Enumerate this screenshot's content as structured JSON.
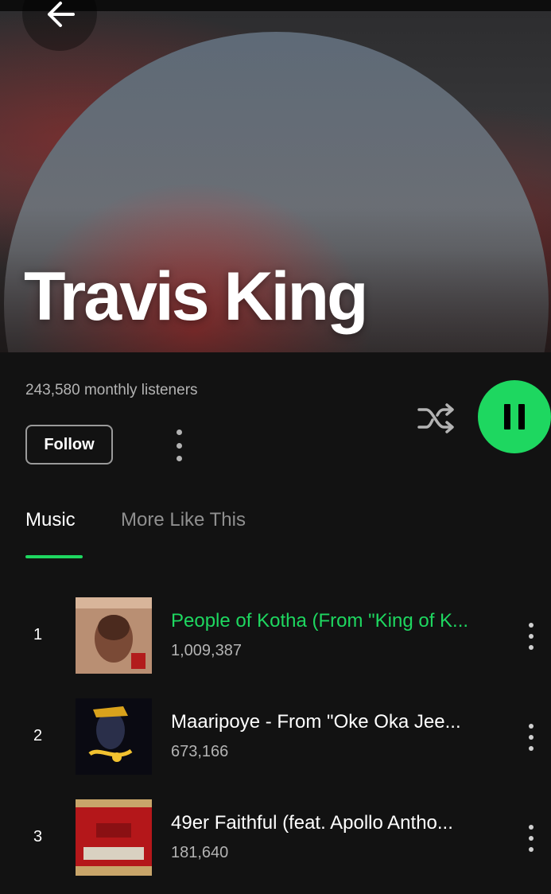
{
  "artist": {
    "name": "Travis King",
    "monthly_listeners": "243,580 monthly listeners"
  },
  "actions": {
    "follow_label": "Follow"
  },
  "tabs": [
    {
      "label": "Music",
      "active": true
    },
    {
      "label": "More Like This",
      "active": false
    }
  ],
  "tracks": [
    {
      "rank": "1",
      "title": "People of Kotha (From \"King of K...",
      "plays": "1,009,387",
      "playing": true
    },
    {
      "rank": "2",
      "title": "Maaripoye - From \"Oke Oka Jee...",
      "plays": "673,166",
      "playing": false
    },
    {
      "rank": "3",
      "title": "49er Faithful (feat. Apollo Antho...",
      "plays": "181,640",
      "playing": false
    }
  ],
  "icons": {
    "back": "arrow-left-icon",
    "more": "more-vertical-icon",
    "shuffle": "shuffle-icon",
    "pause": "pause-icon"
  },
  "colors": {
    "accent": "#1ed760",
    "background": "#121212",
    "secondary_text": "#b3b3b3"
  }
}
